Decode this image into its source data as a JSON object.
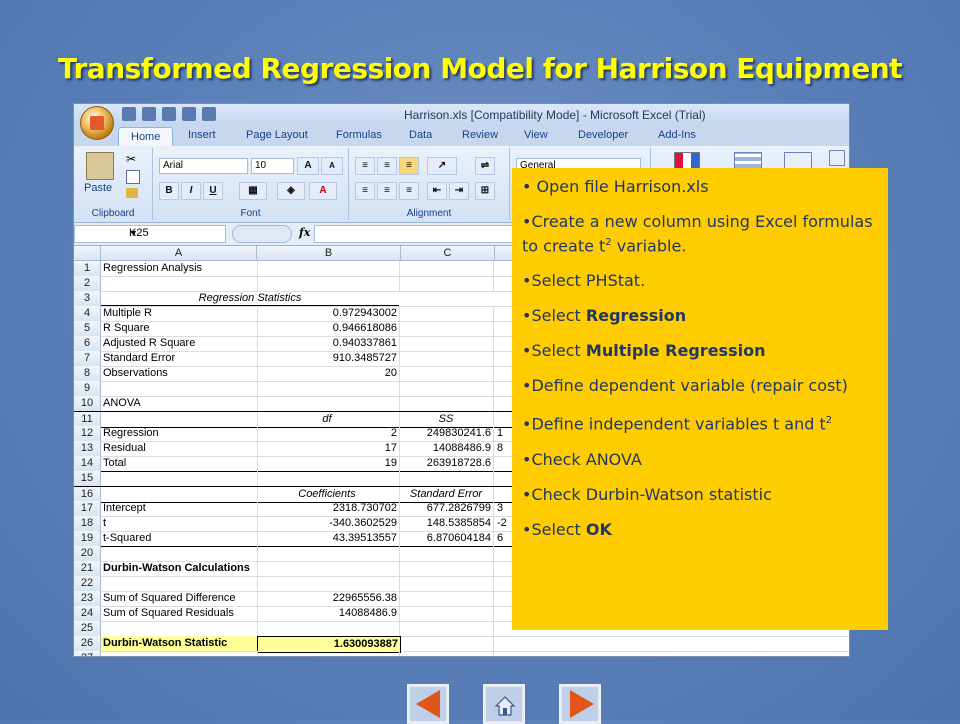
{
  "slide": {
    "title": "Transformed Regression Model for Harrison Equipment"
  },
  "excel": {
    "window_title": "Harrison.xls  [Compatibility Mode]  -  Microsoft Excel (Trial)",
    "tabs": [
      "Home",
      "Insert",
      "Page Layout",
      "Formulas",
      "Data",
      "Review",
      "View",
      "Developer",
      "Add-Ins"
    ],
    "ribbon": {
      "paste_label": "Paste",
      "font_name": "Arial",
      "font_size": "10",
      "number_format": "General",
      "groups": {
        "clipboard": "Clipboard",
        "font": "Font",
        "alignment": "Alignment"
      }
    },
    "name_box": "K25",
    "fx_label": "fx",
    "columns": [
      "A",
      "B",
      "C"
    ],
    "rows": [
      {
        "n": "1",
        "a": "Regression Analysis",
        "b": "",
        "c": ""
      },
      {
        "n": "2",
        "a": "",
        "b": "",
        "c": ""
      },
      {
        "n": "3",
        "span": "Regression Statistics"
      },
      {
        "n": "4",
        "a": "Multiple R",
        "b": "0.972943002",
        "c": ""
      },
      {
        "n": "5",
        "a": "R Square",
        "b": "0.946618086",
        "c": ""
      },
      {
        "n": "6",
        "a": "Adjusted R Square",
        "b": "0.940337861",
        "c": ""
      },
      {
        "n": "7",
        "a": "Standard Error",
        "b": "910.3485727",
        "c": ""
      },
      {
        "n": "8",
        "a": "Observations",
        "b": "20",
        "c": ""
      },
      {
        "n": "9",
        "a": "",
        "b": "",
        "c": ""
      },
      {
        "n": "10",
        "a": "ANOVA",
        "b": "",
        "c": ""
      },
      {
        "n": "11",
        "a": "",
        "b": "df",
        "c": "SS",
        "hdr": true
      },
      {
        "n": "12",
        "a": "Regression",
        "b": "2",
        "c": "249830241.6",
        "d": "1"
      },
      {
        "n": "13",
        "a": "Residual",
        "b": "17",
        "c": "14088486.9",
        "d": "8"
      },
      {
        "n": "14",
        "a": "Total",
        "b": "19",
        "c": "263918728.6",
        "d": ""
      },
      {
        "n": "15",
        "a": "",
        "b": "",
        "c": ""
      },
      {
        "n": "16",
        "a": "",
        "b": "Coefficients",
        "c": "Standard Error",
        "hdr": true
      },
      {
        "n": "17",
        "a": "Intercept",
        "b": "2318.730702",
        "c": "677.2826799",
        "d": "3"
      },
      {
        "n": "18",
        "a": "t",
        "b": "-340.3602529",
        "c": "148.5385854",
        "d": "-2"
      },
      {
        "n": "19",
        "a": "t-Squared",
        "b": "43.39513557",
        "c": "6.870604184",
        "d": "6"
      },
      {
        "n": "20",
        "a": "",
        "b": "",
        "c": ""
      },
      {
        "n": "21",
        "a": "Durbin-Watson Calculations",
        "b": "",
        "c": "",
        "bold": true
      },
      {
        "n": "22",
        "a": "",
        "b": "",
        "c": ""
      },
      {
        "n": "23",
        "a": "Sum of Squared Difference",
        "b": "22965556.38",
        "c": ""
      },
      {
        "n": "24",
        "a": "Sum of Squared Residuals",
        "b": "14088486.9",
        "c": ""
      },
      {
        "n": "25",
        "a": "",
        "b": "",
        "c": ""
      },
      {
        "n": "26",
        "a": "Durbin-Watson Statistic",
        "b": "1.630093887",
        "c": "",
        "highlight": true
      },
      {
        "n": "27",
        "a": "",
        "b": "",
        "c": ""
      }
    ]
  },
  "instructions": {
    "i1": "Open file Harrison.xls",
    "i2_pre": "Create a new column using Excel formulas to create t",
    "i2_sup": "2",
    "i2_post": " variable.",
    "i3": "Select PHStat.",
    "i4_pre": "Select ",
    "i4_bold": "Regression",
    "i5_pre": "Select ",
    "i5_bold": "Multiple Regression",
    "i6": "Define dependent variable (repair cost)",
    "i7_pre": "Define independent variables t and t",
    "i7_sup": "2",
    "i8": "Check ANOVA",
    "i9": "Check Durbin-Watson statistic",
    "i10_pre": "Select ",
    "i10_bold": "OK",
    "bullet": "•"
  },
  "colors": {
    "title": "#ffff00",
    "instruction_box": "#ffcc00",
    "nav_arrow": "#e0561a"
  },
  "nav": {
    "prev": "previous-slide",
    "home": "home",
    "next": "next-slide"
  }
}
